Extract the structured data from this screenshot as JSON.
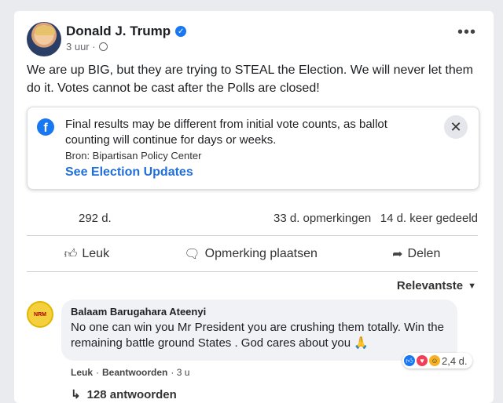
{
  "post": {
    "author": "Donald J. Trump",
    "time": "3 uur ·",
    "text": "We are up BIG, but they are trying to STEAL the Election. We will never let them do it. Votes cannot be cast after the Polls are closed!"
  },
  "notice": {
    "text": "Final results may be different from initial vote counts, as ballot counting will continue for days or weeks.",
    "source": "Bron: Bipartisan Policy Center",
    "link": "See Election Updates"
  },
  "stats": {
    "likes": "292 d.",
    "comments": "33 d. opmerkingen",
    "shares": "14 d. keer gedeeld"
  },
  "actions": {
    "like": "Leuk",
    "comment": "Opmerking plaatsen",
    "share": "Delen"
  },
  "sort_label": "Relevantste",
  "comment": {
    "author": "Balaam Barugahara Ateenyi",
    "text": "No one can win you Mr President you are crushing them totally. Win the remaining battle ground States . God cares about you 🙏",
    "reaction_count": "2,4 d.",
    "like_label": "Leuk",
    "reply_label": "Beantwoorden",
    "time": "· 3 u",
    "replies": "128 antwoorden"
  },
  "icons": [
    "verified-icon",
    "globe-icon",
    "more-icon",
    "facebook-icon",
    "close-icon",
    "like-icon",
    "comment-icon",
    "share-icon",
    "caret-down-icon",
    "reply-arrow-icon"
  ],
  "colors": {
    "accent": "#1877f2",
    "link": "#216fdb"
  }
}
